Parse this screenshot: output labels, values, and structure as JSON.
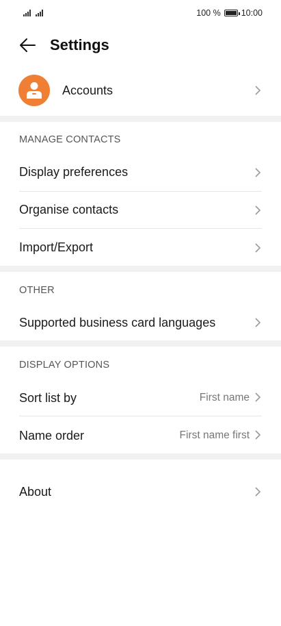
{
  "status": {
    "battery_text": "100 %",
    "time": "10:00"
  },
  "header": {
    "title": "Settings"
  },
  "accounts": {
    "label": "Accounts"
  },
  "manage": {
    "title": "MANAGE CONTACTS",
    "items": [
      {
        "label": "Display preferences"
      },
      {
        "label": "Organise contacts"
      },
      {
        "label": "Import/Export"
      }
    ]
  },
  "other": {
    "title": "OTHER",
    "items": [
      {
        "label": "Supported business card languages"
      }
    ]
  },
  "display": {
    "title": "DISPLAY OPTIONS",
    "items": [
      {
        "label": "Sort list by",
        "value": "First name"
      },
      {
        "label": "Name order",
        "value": "First name first"
      }
    ]
  },
  "about": {
    "label": "About"
  },
  "colors": {
    "accent": "#ef7f34",
    "section_gap": "#f1f1f1"
  }
}
